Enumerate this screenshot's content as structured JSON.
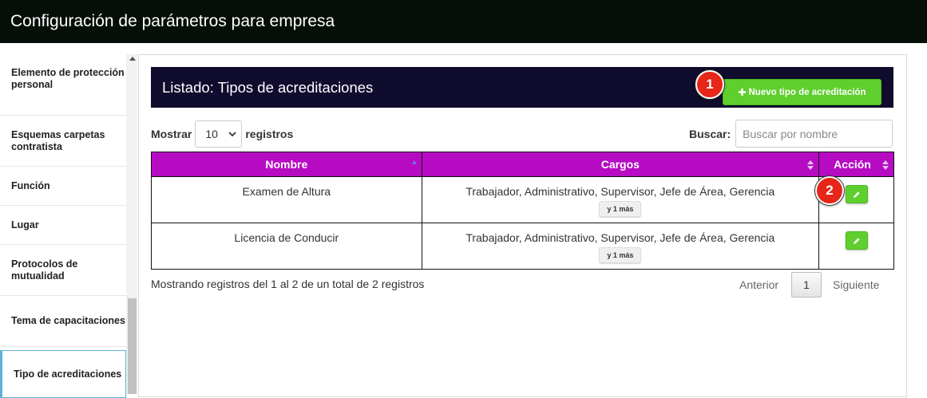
{
  "page": {
    "title": "Configuración de parámetros para empresa"
  },
  "sidebar": {
    "items": [
      {
        "label": "Elemento de protección personal"
      },
      {
        "label": "Esquemas carpetas contratista"
      },
      {
        "label": "Función"
      },
      {
        "label": "Lugar"
      },
      {
        "label": "Protocolos de mutualidad"
      },
      {
        "label": "Tema de capacitaciones"
      },
      {
        "label": "Tipo de acreditaciones",
        "active": true
      }
    ]
  },
  "list": {
    "title": "Listado: Tipos de acreditaciones",
    "new_button": "Nuevo tipo de acreditación",
    "new_icon": "plus-icon"
  },
  "badges": [
    "1",
    "2"
  ],
  "length_control": {
    "prefix": "Mostrar",
    "value": "10",
    "suffix": "registros"
  },
  "search": {
    "label": "Buscar:",
    "placeholder": "Buscar por nombre"
  },
  "table": {
    "columns": [
      "Nombre",
      "Cargos",
      "Acción"
    ],
    "rows": [
      {
        "nombre": "Examen de Altura",
        "cargos": "Trabajador, Administrativo, Supervisor, Jefe de Área, Gerencia",
        "more": "y 1 más"
      },
      {
        "nombre": "Licencia de Conducir",
        "cargos": "Trabajador, Administrativo, Supervisor, Jefe de Área, Gerencia",
        "more": "y 1 más"
      }
    ]
  },
  "footer": {
    "info": "Mostrando registros del 1 al 2 de un total de 2 registros",
    "prev": "Anterior",
    "page": "1",
    "next": "Siguiente"
  },
  "colors": {
    "topbar": "#060e08",
    "list_header": "#100c2e",
    "table_header": "#b60bc3",
    "accent_green": "#5fcf2e",
    "badge_red": "#e52619"
  }
}
